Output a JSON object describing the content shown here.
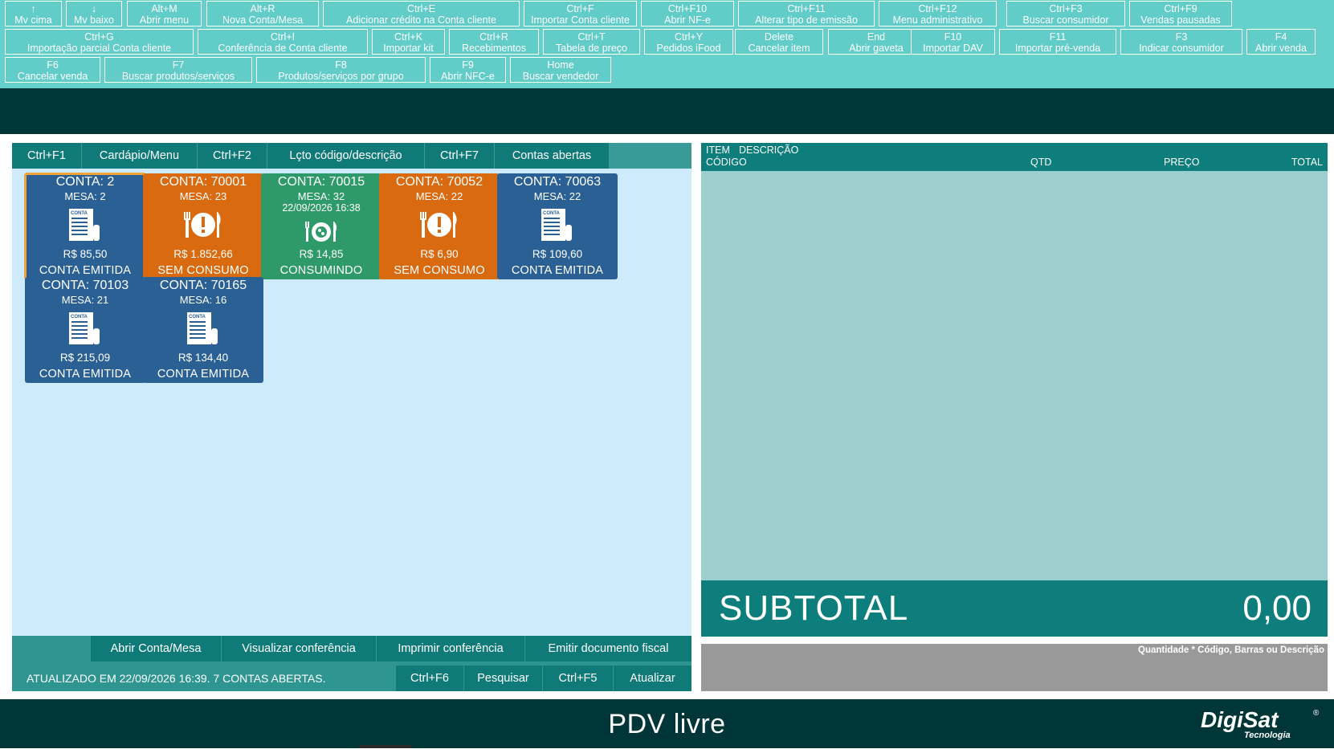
{
  "shortcuts": [
    {
      "key": "↑",
      "label": "Mv cima"
    },
    {
      "key": "↓",
      "label": "Mv baixo"
    },
    {
      "key": "Alt+M",
      "label": "Abrir menu"
    },
    {
      "key": "Alt+R",
      "label": "Nova Conta/Mesa"
    },
    {
      "key": "Ctrl+E",
      "label": "Adicionar crédito na Conta cliente"
    },
    {
      "key": "Ctrl+F",
      "label": "Importar Conta cliente"
    },
    {
      "key": "Ctrl+F10",
      "label": "Abrir NF-e"
    },
    {
      "key": "Ctrl+F11",
      "label": "Alterar tipo de emissão"
    },
    {
      "key": "Ctrl+F12",
      "label": "Menu administrativo"
    },
    {
      "key": "Ctrl+F3",
      "label": "Buscar consumidor"
    },
    {
      "key": "Ctrl+F9",
      "label": "Vendas pausadas"
    },
    {
      "key": "Ctrl+G",
      "label": "Importação parcial Conta cliente"
    },
    {
      "key": "Ctrl+I",
      "label": "Conferência de Conta cliente"
    },
    {
      "key": "Ctrl+K",
      "label": "Importar kit"
    },
    {
      "key": "Ctrl+R",
      "label": "Recebimentos"
    },
    {
      "key": "Ctrl+T",
      "label": "Tabela de preço"
    },
    {
      "key": "Ctrl+Y",
      "label": "Pedidos iFood"
    },
    {
      "key": "Delete",
      "label": "Cancelar item"
    },
    {
      "key": "End",
      "label": "Abrir gaveta"
    },
    {
      "key": "F10",
      "label": "Importar DAV"
    },
    {
      "key": "F11",
      "label": "Importar pré-venda"
    },
    {
      "key": "F3",
      "label": "Indicar consumidor"
    },
    {
      "key": "F4",
      "label": "Abrir venda"
    },
    {
      "key": "F6",
      "label": "Cancelar venda"
    },
    {
      "key": "F7",
      "label": "Buscar produtos/serviços"
    },
    {
      "key": "F8",
      "label": "Produtos/serviços por grupo"
    },
    {
      "key": "F9",
      "label": "Abrir NFC-e"
    },
    {
      "key": "Home",
      "label": "Buscar vendedor"
    }
  ],
  "tabs": [
    {
      "key": "Ctrl+F1",
      "label": "Cardápio/Menu"
    },
    {
      "key": "Ctrl+F2",
      "label": "Lçto código/descrição"
    },
    {
      "key": "Ctrl+F7",
      "label": "Contas abertas"
    }
  ],
  "accounts": [
    {
      "title": "CONTA:  2",
      "mesa": "MESA: 2",
      "date": "",
      "value": "R$ 85,50",
      "status": "CONTA EMITIDA",
      "icon": "receipt-icon"
    },
    {
      "title": "CONTA:  70001",
      "mesa": "MESA: 23",
      "date": "",
      "value": "R$ 1.852,66",
      "status": "SEM CONSUMO",
      "icon": "plate-alert-icon"
    },
    {
      "title": "CONTA:  70015",
      "mesa": "MESA: 32",
      "date": "22/09/2026 16:38",
      "value": "R$ 14,85",
      "status": "CONSUMINDO",
      "icon": "serving-plate-icon"
    },
    {
      "title": "CONTA:  70052",
      "mesa": "MESA: 22",
      "date": "",
      "value": "R$ 6,90",
      "status": "SEM CONSUMO",
      "icon": "plate-alert-icon"
    },
    {
      "title": "CONTA:  70063",
      "mesa": "MESA: 22",
      "date": "",
      "value": "R$ 109,60",
      "status": "CONTA EMITIDA",
      "icon": "receipt-icon"
    },
    {
      "title": "CONTA:  70103",
      "mesa": "MESA: 21",
      "date": "",
      "value": "R$ 215,09",
      "status": "CONTA EMITIDA",
      "icon": "receipt-icon"
    },
    {
      "title": "CONTA:  70165",
      "mesa": "MESA: 16",
      "date": "",
      "value": "R$ 134,40",
      "status": "CONTA EMITIDA",
      "icon": "receipt-icon"
    }
  ],
  "receipt_icon_text": "CONTA",
  "actions": {
    "open_account": "Abrir Conta/Mesa",
    "view_check": "Visualizar conferência",
    "print_check": "Imprimir conferência",
    "emit_fiscal": "Emitir documento fiscal",
    "search_key": "Ctrl+F6",
    "search_label": "Pesquisar",
    "refresh_key": "Ctrl+F5",
    "refresh_label": "Atualizar"
  },
  "status_text": "ATUALIZADO EM 22/09/2026 16:39. 7 CONTAS ABERTAS.",
  "item_table": {
    "col_item": "ITEM",
    "col_descricao": "DESCRIÇÃO",
    "col_codigo": "CÓDIGO",
    "col_qtd": "QTD",
    "col_preco": "PREÇO",
    "col_total": "TOTAL"
  },
  "subtotal": {
    "label": "SUBTOTAL",
    "value": "0,00"
  },
  "input_hint": "Quantidade * Código, Barras ou Descrição",
  "footer_status": "PDV livre",
  "logo": {
    "name": "DigiSat",
    "sub": "Tecnologia",
    "mark": "®"
  },
  "colors": {
    "shortcut_bar": "#66d0cc",
    "dark_teal": "#013638",
    "panel_teal": "#0d7e7b",
    "emitida_blue": "#2b6095",
    "semconsumo_orange": "#d96a0f",
    "consumindo_green": "#2f9a69",
    "selected_outline": "#f0a43a"
  }
}
